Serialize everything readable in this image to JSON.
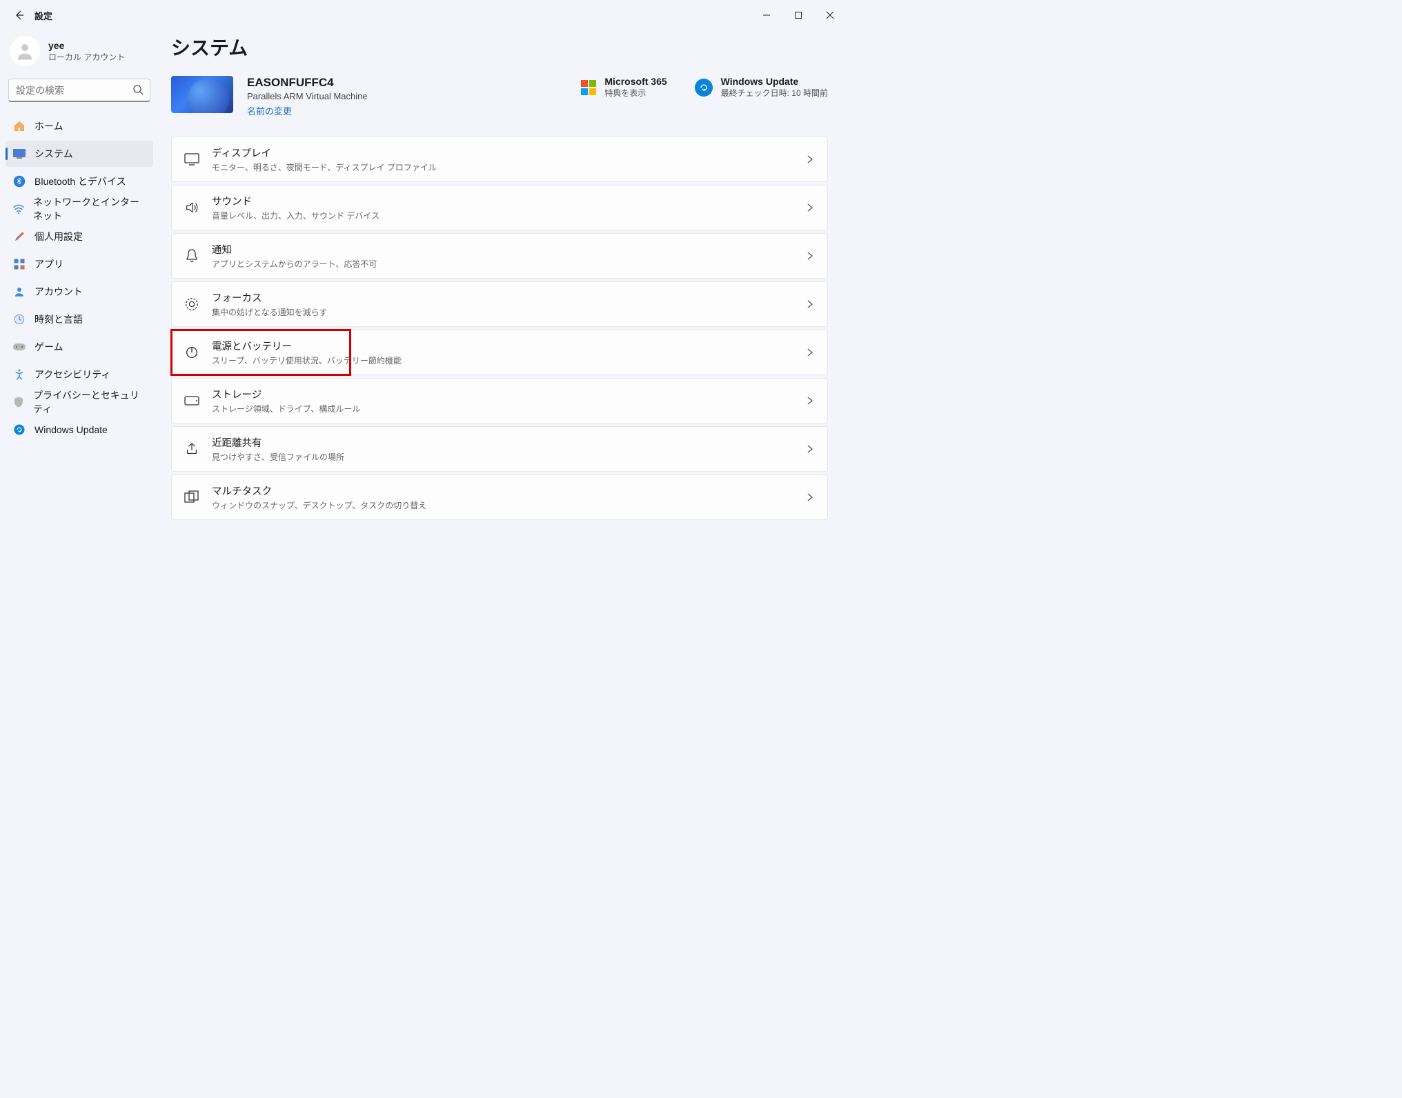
{
  "app": {
    "title": "設定"
  },
  "user": {
    "name": "yee",
    "sub": "ローカル アカウント"
  },
  "search": {
    "placeholder": "設定の検索"
  },
  "nav": {
    "home": "ホーム",
    "system": "システム",
    "bluetooth": "Bluetooth とデバイス",
    "network": "ネットワークとインターネット",
    "personalization": "個人用設定",
    "apps": "アプリ",
    "accounts": "アカウント",
    "time": "時刻と言語",
    "gaming": "ゲーム",
    "accessibility": "アクセシビリティ",
    "privacy": "プライバシーとセキュリティ",
    "update": "Windows Update"
  },
  "page": {
    "title": "システム"
  },
  "device": {
    "name": "EASONFUFFC4",
    "sub": "Parallels ARM Virtual Machine",
    "rename": "名前の変更"
  },
  "tiles": {
    "ms365": {
      "title": "Microsoft 365",
      "sub": "特典を表示"
    },
    "wu": {
      "title": "Windows Update",
      "sub": "最終チェック日時: 10 時間前"
    }
  },
  "cards": {
    "display": {
      "title": "ディスプレイ",
      "sub": "モニター、明るさ、夜間モード、ディスプレイ プロファイル"
    },
    "sound": {
      "title": "サウンド",
      "sub": "音量レベル、出力、入力、サウンド デバイス"
    },
    "notifications": {
      "title": "通知",
      "sub": "アプリとシステムからのアラート、応答不可"
    },
    "focus": {
      "title": "フォーカス",
      "sub": "集中の妨げとなる通知を減らす"
    },
    "power": {
      "title": "電源とバッテリー",
      "sub": "スリープ、バッテリ使用状況、バッテリー節約機能"
    },
    "storage": {
      "title": "ストレージ",
      "sub": "ストレージ領域、ドライブ、構成ルール"
    },
    "nearby": {
      "title": "近距離共有",
      "sub": "見つけやすさ、受信ファイルの場所"
    },
    "multitask": {
      "title": "マルチタスク",
      "sub": "ウィンドウのスナップ、デスクトップ、タスクの切り替え"
    }
  }
}
